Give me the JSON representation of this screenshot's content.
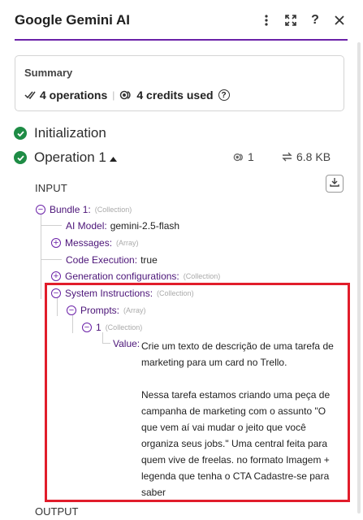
{
  "header": {
    "title": "Google Gemini AI",
    "icons": [
      "more-vertical-icon",
      "expand-icon",
      "help-icon",
      "close-icon"
    ]
  },
  "summary": {
    "label": "Summary",
    "operations": "4 operations",
    "credits": "4 credits used"
  },
  "steps": {
    "initialization": "Initialization",
    "operation": "Operation 1",
    "op_count": "1",
    "op_size": "6.8 KB"
  },
  "input": {
    "label": "INPUT",
    "bundle_key": "Bundle 1:",
    "bundle_type": "(Collection)",
    "ai_model_key": "AI Model:",
    "ai_model_val": "gemini-2.5-flash",
    "messages_key": "Messages:",
    "messages_type": "(Array)",
    "code_exec_key": "Code Execution:",
    "code_exec_val": "true",
    "gen_config_key": "Generation configurations:",
    "gen_config_type": "(Collection)",
    "sys_instr_key": "System Instructions:",
    "sys_instr_type": "(Collection)",
    "prompts_key": "Prompts:",
    "prompts_type": "(Array)",
    "item_key": "1",
    "item_type": "(Collection)",
    "value_key": "Value:",
    "value_text": "Crie um texto de descrição de uma tarefa de marketing para um card no Trello.\n\nNessa tarefa estamos criando uma peça de campanha de marketing com o assunto \"O que vem aí vai mudar o jeito que você organiza seus jobs.\" Uma central feita para quem vive de freelas. no formato Imagem + legenda que tenha o CTA Cadastre-se para saber"
  },
  "output": {
    "label": "OUTPUT"
  },
  "colors": {
    "accent": "#6b21a8",
    "success": "#1e8c45",
    "highlight": "#e11d2b"
  }
}
